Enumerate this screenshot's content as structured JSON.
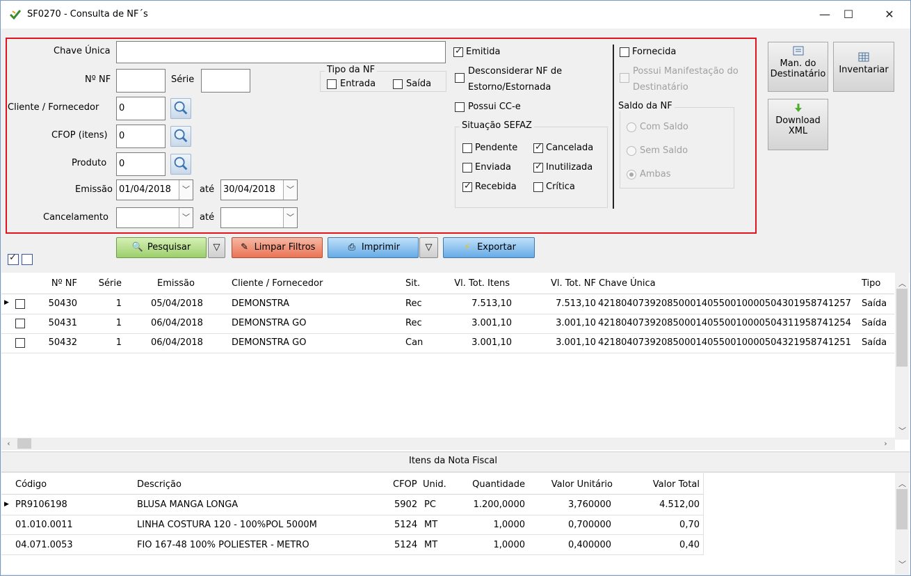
{
  "window": {
    "title": "SF0270 - Consulta de NF´s",
    "minimize": "—",
    "maximize": "☐",
    "close": "✕"
  },
  "filters": {
    "chave_label": "Chave Única",
    "chave_value": "",
    "nf_label": "Nº NF",
    "nf_value": "",
    "serie_label": "Série",
    "serie_value": "",
    "tipo_nf_title": "Tipo da NF",
    "entrada": "Entrada",
    "saida": "Saída",
    "cliente_label": "Cliente / Fornecedor",
    "cliente_value": "0",
    "cfop_label": "CFOP (itens)",
    "cfop_value": "0",
    "produto_label": "Produto",
    "produto_value": "0",
    "emissao_label": "Emissão",
    "emissao_de": "01/04/2018",
    "ate1": "até",
    "emissao_ate": "30/04/2018",
    "cancel_label": "Cancelamento",
    "cancel_de": "",
    "ate2": "até",
    "cancel_ate": "",
    "emitida": "Emitida",
    "desconsiderar_1": "Desconsiderar NF de",
    "desconsiderar_2": "Estorno/Estornada",
    "possui_cce": "Possui CC-e",
    "sefaz_title": "Situação SEFAZ",
    "pendente": "Pendente",
    "cancelada": "Cancelada",
    "enviada": "Enviada",
    "inutilizada": "Inutilizada",
    "recebida": "Recebida",
    "critica": "Crítica",
    "fornecida": "Fornecida",
    "manif_1": "Possui Manifestação do",
    "manif_2": "Destinatário",
    "saldo_title": "Saldo da NF",
    "com_saldo": "Com Saldo",
    "sem_saldo": "Sem Saldo",
    "ambas": "Ambas"
  },
  "side_buttons": {
    "man_1": "Man. do",
    "man_2": "Destinatário",
    "inventariar": "Inventariar",
    "download_1": "Download",
    "download_2": "XML"
  },
  "toolbar": {
    "pesquisar": "Pesquisar",
    "limpar": "Limpar Filtros",
    "imprimir": "Imprimir",
    "exportar": "Exportar"
  },
  "nf_grid": {
    "headers": {
      "nf": "Nº NF",
      "serie": "Série",
      "emissao": "Emissão",
      "cliente": "Cliente / Fornecedor",
      "sit": "Sit.",
      "vl_itens": "Vl. Tot. Itens",
      "vl_nf": "Vl. Tot. NF",
      "chave": "Chave Única",
      "tipo": "Tipo"
    },
    "rows": [
      {
        "nf": "50430",
        "serie": "1",
        "emissao": "05/04/2018",
        "cliente": "DEMONSTRA",
        "sit": "Rec",
        "vl_itens": "7.513,10",
        "vl_nf": "7.513,10",
        "chave": "42180407392085000140550010000504301958741257",
        "tipo": "Saída"
      },
      {
        "nf": "50431",
        "serie": "1",
        "emissao": "06/04/2018",
        "cliente": "DEMONSTRA GO",
        "sit": "Rec",
        "vl_itens": "3.001,10",
        "vl_nf": "3.001,10",
        "chave": "42180407392085000140550010000504311958741254",
        "tipo": "Saída"
      },
      {
        "nf": "50432",
        "serie": "1",
        "emissao": "06/04/2018",
        "cliente": "DEMONSTRA GO",
        "sit": "Can",
        "vl_itens": "3.001,10",
        "vl_nf": "3.001,10",
        "chave": "42180407392085000140550010000504321958741251",
        "tipo": "Saída"
      }
    ]
  },
  "items_section": {
    "title": "Itens da Nota Fiscal"
  },
  "items_grid": {
    "headers": {
      "codigo": "Código",
      "descricao": "Descrição",
      "cfop": "CFOP",
      "unid": "Unid.",
      "qtd": "Quantidade",
      "vl_unit": "Valor Unitário",
      "vl_total": "Valor Total"
    },
    "rows": [
      {
        "codigo": "PR9106198",
        "descricao": "BLUSA MANGA LONGA",
        "cfop": "5902",
        "unid": "PC",
        "qtd": "1.200,0000",
        "vl_unit": "3,760000",
        "vl_total": "4.512,00"
      },
      {
        "codigo": "01.010.0011",
        "descricao": "LINHA COSTURA 120 - 100%POL 5000M",
        "cfop": "5124",
        "unid": "MT",
        "qtd": "1,0000",
        "vl_unit": "0,700000",
        "vl_total": "0,70"
      },
      {
        "codigo": "04.071.0053",
        "descricao": "FIO 167-48  100% POLIESTER - METRO",
        "cfop": "5124",
        "unid": "MT",
        "qtd": "1,0000",
        "vl_unit": "0,400000",
        "vl_total": "0,40"
      }
    ]
  },
  "colors": {
    "filter_border": "#e0141e",
    "pesquisar": "#9ccf6c",
    "limpar": "#ea7455",
    "imprimir": "#66abe6"
  }
}
